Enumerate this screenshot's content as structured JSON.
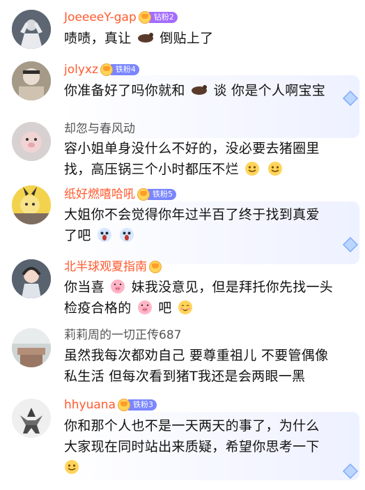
{
  "colors": {
    "name_orange": "#ff5a2e",
    "name_gray": "#555555",
    "badge_blue": "#7a86ff",
    "badge_purple": "#a46cff",
    "bubble_tint": "#eef1ff",
    "diamond_blue": "#8ab9ff"
  },
  "comments": [
    {
      "name": "JoeeeeY-gap",
      "name_color": "#ff5a2e",
      "badge": "钻粉2",
      "lines": [
        "啧啧，真让",
        "倒贴上了"
      ],
      "has_diamond": false,
      "emoji": [
        "slug-icon"
      ]
    },
    {
      "name": "jolyxz",
      "name_color": "#ff5a2e",
      "badge": "铁粉4",
      "lines": [
        "你准备好了吗你就和",
        "谈 你是个人啊宝宝"
      ],
      "has_diamond": true,
      "emoji": [
        "slug-icon"
      ]
    },
    {
      "name": "却忽与春风动",
      "name_color": "#555555",
      "badge": "",
      "lines": [
        "容小姐单身没什么不好的，没必要去猪圈里",
        "找，高压锅三个小时都压不烂"
      ],
      "has_diamond": false,
      "emoji": [
        "smile-face-icon",
        "smile-face-icon"
      ]
    },
    {
      "name": "纸好燃嘻哈吼",
      "name_color": "#ff5a2e",
      "badge": "铁粉5",
      "lines": [
        "大姐你不会觉得你年过半百了终于找到真爱",
        "了吧"
      ],
      "has_diamond": true,
      "emoji": [
        "shocked-face-icon",
        "shocked-face-icon"
      ]
    },
    {
      "name": "北半球观夏指南",
      "name_color": "#ff5a2e",
      "badge": "",
      "lines": [
        "你当喜",
        "妹我没意见，但是拜托你先找一头",
        "检疫合格的",
        "吧"
      ],
      "has_diamond": false,
      "emoji": [
        "pig-face-icon",
        "pig-face-icon",
        "blush-face-icon"
      ]
    },
    {
      "name": "莉莉周的一切正传687",
      "name_color": "#555555",
      "badge": "",
      "lines": [
        "虽然我每次都劝自己 要尊重祖儿 不要管偶像",
        "私生活 但每次看到猪T我还是会两眼一黑"
      ],
      "has_diamond": false,
      "emoji": []
    },
    {
      "name": "hhyuana",
      "name_color": "#ff5a2e",
      "badge": "铁粉3",
      "lines": [
        "你和那个人也不是一天两天的事了，为什么",
        "大家现在同时站出来质疑，希望你思考一下"
      ],
      "has_diamond": true,
      "emoji": [
        "smile-face-icon"
      ]
    }
  ]
}
